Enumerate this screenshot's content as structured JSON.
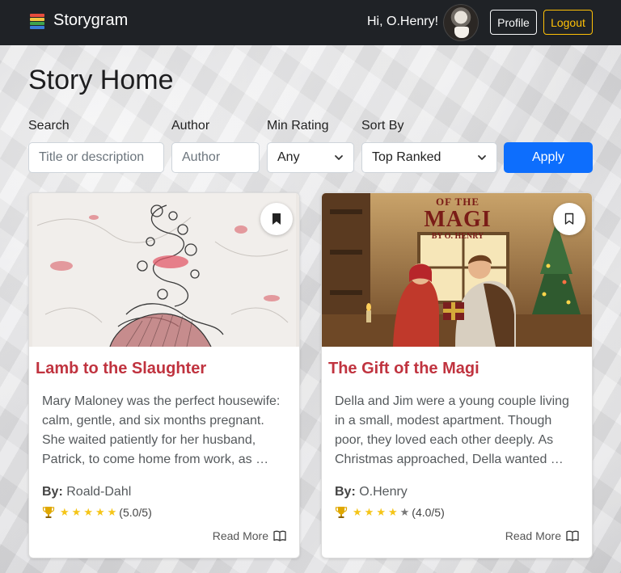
{
  "navbar": {
    "brand": "Storygram",
    "greeting": "Hi, O.Henry!",
    "profile_label": "Profile",
    "logout_label": "Logout"
  },
  "page": {
    "title": "Story Home"
  },
  "filters": {
    "search_label": "Search",
    "search_placeholder": "Title or description",
    "author_label": "Author",
    "author_placeholder": "Author",
    "min_rating_label": "Min Rating",
    "min_rating_value": "Any",
    "sort_label": "Sort By",
    "sort_value": "Top Ranked",
    "apply_label": "Apply"
  },
  "stories": [
    {
      "title": "Lamb to the Slaughter",
      "description": "Mary Maloney was the perfect housewife: calm, gentle, and six months pregnant. She waited patiently for her husband, Patrick, to come home from work, as …",
      "by_label": "By:",
      "author": "Roald-Dahl",
      "rating": 5,
      "rating_text": "(5.0/5)",
      "bookmarked": true,
      "read_more": "Read More"
    },
    {
      "title": "The Gift of the Magi",
      "description": "Della and Jim were a young couple living in a small, modest apartment. Though poor, they loved each other deeply. As Christmas approached, Della wanted …",
      "by_label": "By:",
      "author": "O.Henry",
      "rating": 4,
      "rating_text": "(4.0/5)",
      "bookmarked": false,
      "read_more": "Read More",
      "cover_text": {
        "top": "OF THE",
        "main": "MAGI",
        "byline": "BY O. HENRY"
      }
    }
  ],
  "colors": {
    "navbar": "#1f2226",
    "title_accent": "#c0333f",
    "apply": "#0d6efd",
    "logout": "#ffc107",
    "star": "#f5c518"
  }
}
